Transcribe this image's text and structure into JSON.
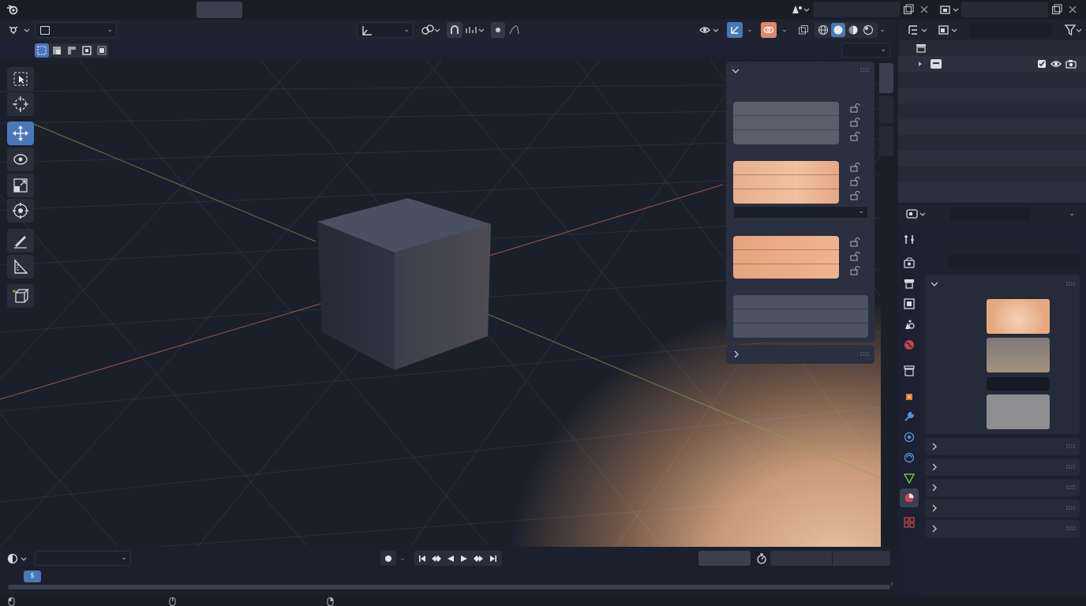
{
  "app": {
    "logo_icon": "blender-logo-icon",
    "workspace_tab_label": ""
  },
  "topbar": {
    "scene_field_value": "",
    "viewlayer_field_value": ""
  },
  "viewport_header": {
    "editor_type_icon": "view3d-editor-icon",
    "mode_select_value": "",
    "transform_orientation_value": "",
    "pivot_icon": "pivot-point-icon",
    "snap_icon": "magnet-icon",
    "proportional_icon": "proportional-edit-icon",
    "visibility_icon": "eye-visibility-icon",
    "gizmo_icon": "gizmo-icon",
    "overlay_icon": "overlay-icon",
    "xray_icon": "xray-icon",
    "shading_modes": [
      "wireframe",
      "solid",
      "material-preview",
      "rendered"
    ],
    "shading_active": "solid",
    "options_dropdown_value": ""
  },
  "toolbar": {
    "tools": [
      {
        "name": "select-box-tool",
        "active": false
      },
      {
        "name": "cursor-tool",
        "active": false
      },
      {
        "name": "move-tool",
        "active": true
      },
      {
        "name": "rotate-tool",
        "active": false
      },
      {
        "name": "scale-tool",
        "active": false
      },
      {
        "name": "transform-tool",
        "active": false
      },
      {
        "name": "annotate-tool",
        "active": false
      },
      {
        "name": "measure-tool",
        "active": false
      },
      {
        "name": "add-cube-tool",
        "active": false
      }
    ],
    "select_modes": [
      "set",
      "extend",
      "subtract",
      "invert",
      "intersect"
    ]
  },
  "npanel": {
    "transform_section_expanded": true,
    "location_values": [
      "",
      "",
      ""
    ],
    "rotation_values": [
      "",
      "",
      ""
    ],
    "rotation_mode_value": "",
    "scale_values": [
      "",
      "",
      ""
    ],
    "dimensions_values": [
      "",
      "",
      ""
    ],
    "collapsed_section_label": ""
  },
  "outliner": {
    "search_value": "",
    "collection_label": "",
    "filter_icon": "filter-icon"
  },
  "properties": {
    "search_value": "",
    "path_value": "",
    "tabs": [
      "tool",
      "render",
      "output",
      "view-layer",
      "scene",
      "world",
      "collection",
      "object",
      "modifiers",
      "particles",
      "physics",
      "object-data",
      "material",
      "texture"
    ],
    "active_tab": "material",
    "preview_swatches": [
      "#e9b58f",
      "#8c8580",
      "#171a22",
      "#8e8e91"
    ],
    "collapsed_sections": [
      "",
      "",
      "",
      "",
      ""
    ]
  },
  "timeline": {
    "editor_icon": "clock-timeline-icon",
    "mode_dropdown_value": "",
    "playhead_frame_label": "$",
    "current_frame_value": "",
    "start_value": "",
    "end_value": ""
  },
  "colors": {
    "accent_blue": "#4a77b8",
    "panel_bg": "#2b3040",
    "peach_field": "#e9b08a",
    "x_axis": "#c66a56",
    "y_axis": "#8aa14e"
  }
}
